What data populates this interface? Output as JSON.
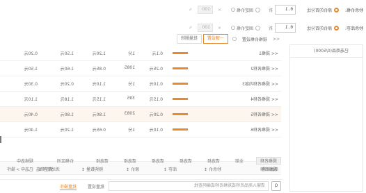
{
  "row1": {
    "label": "秒杀价格:",
    "opt1": "原价的百分比",
    "value": "0.1",
    "unit": "折",
    "opt2": "固定价格",
    "x": "×",
    "placeholder": "100"
  },
  "row2": {
    "label": "秒杀库存:",
    "opt1": "原价的百分比",
    "value": "0.1",
    "unit": "折",
    "opt2": "固定价格",
    "x": "×",
    "placeholder": "100"
  },
  "left_panel": {
    "title": "已选商品(0/5000)"
  },
  "tabs": {
    "collapse": "<<",
    "group": "规格价格设置",
    "chip": "一键设置",
    "chip2": "批量删除"
  },
  "rows": [
    {
      "name": "<< 规格1",
      "a": "0.1元",
      "b": "1分",
      "c": "1.20元",
      "d": "1.50元",
      "e": "0.20元"
    },
    {
      "name": "<< 规格名称2",
      "a": "0.25元",
      "b": "1085",
      "c": "0.85元",
      "d": "1.60元",
      "e": "1.50元"
    },
    {
      "name": "<< 规格名称内容3",
      "a": "0.10元",
      "b": "1分",
      "c": "1.10元",
      "d": "0.20元",
      "e": "0.30元"
    },
    {
      "name": "<< 规格名称4",
      "a": "0.15元",
      "b": "395",
      "c": "1.15元",
      "d": "1.18元",
      "e": "1.10元"
    },
    {
      "name": "<< 规格名称5",
      "a": "0.20元",
      "b": "2083",
      "c": "1.80元",
      "d": "1.80元",
      "e": "0.40元"
    },
    {
      "name": "<< 规格名称6",
      "a": "0.10元",
      "b": "1分",
      "c": "0.65元",
      "d": "1.20元",
      "e": "1.40元"
    }
  ],
  "header": {
    "c1": "商品名称",
    "c2": "秒杀价 ↕",
    "c3": "库存 ↕",
    "c4": "原价 ↕",
    "c5": "限购数量 ↕",
    "c6": "活动库存 ↕",
    "c7": "操作"
  },
  "filter1": {
    "a": "规格名称",
    "b": "全部",
    "c": "请选择",
    "d": "请选择",
    "e": "请选择",
    "f": "请选择",
    "g": "请选择",
    "h": "价格区间",
    "i": "规格选中"
  },
  "filter2": {
    "a": "规格名称",
    "b": "清空筛选",
    "c": "已选中 >"
  },
  "bottom": {
    "btn": "Q",
    "placeholder": "请输入商品名称或规格名称或编码查找",
    "t1": "批量设置",
    "t2": "批量操作"
  }
}
